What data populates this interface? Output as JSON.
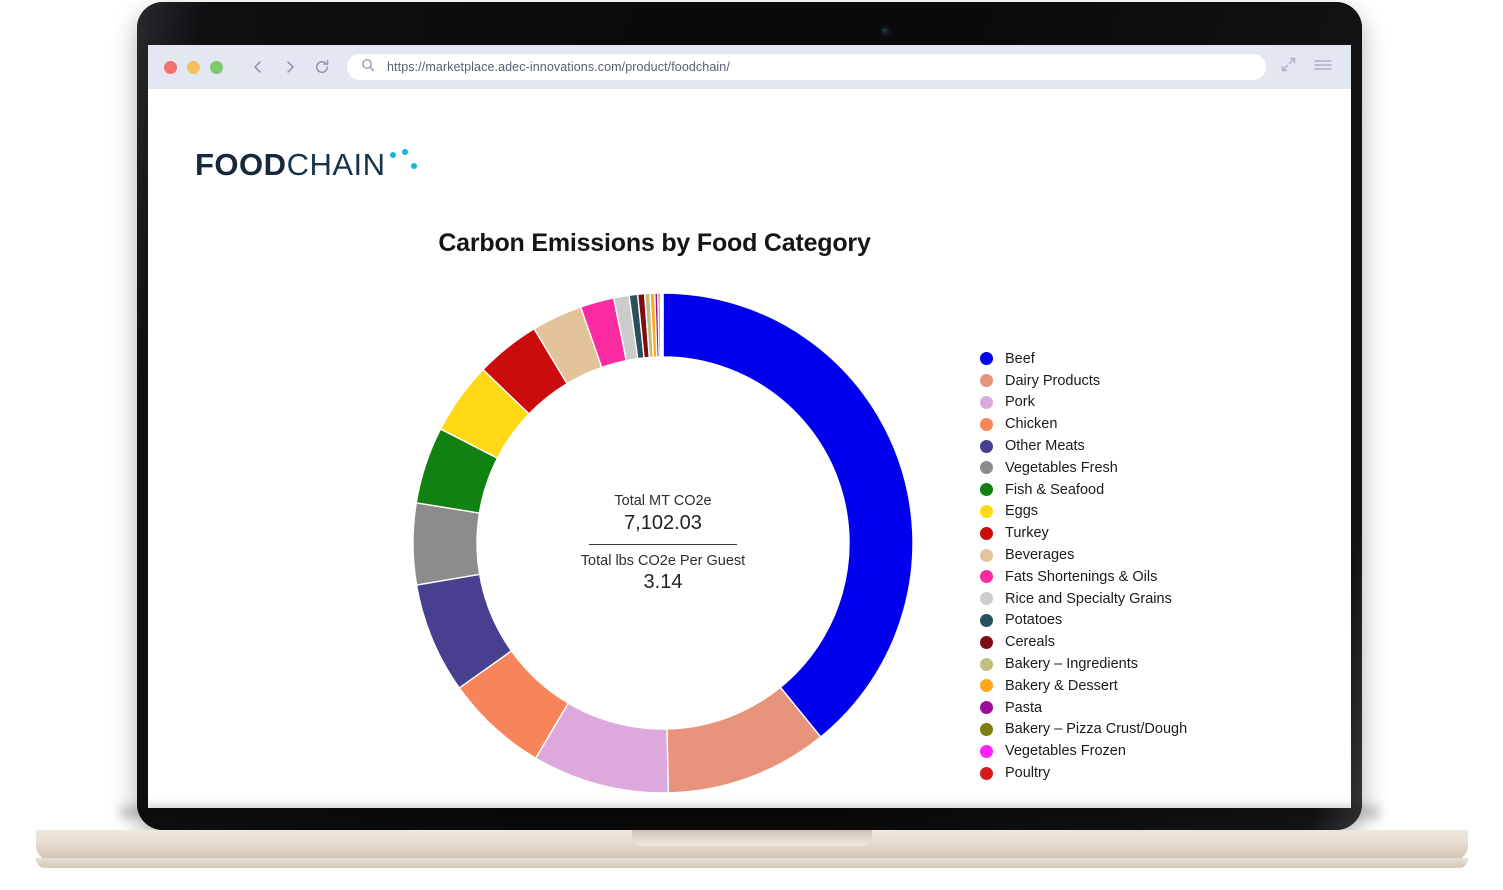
{
  "browser": {
    "url": "https://marketplace.adec-innovations.com/product/foodchain/",
    "traffic_lights": [
      "close",
      "minimize",
      "maximize"
    ],
    "back_icon": "chevron-left-icon",
    "forward_icon": "chevron-right-icon",
    "reload_icon": "reload-icon",
    "search_icon": "search-icon",
    "fullscreen_icon": "expand-arrows-icon",
    "menu_icon": "hamburger-menu-icon"
  },
  "brand": {
    "word_bold": "FOOD",
    "word_light": "CHAIN",
    "dot_color": "#12b6d6",
    "text_color": "#16283a"
  },
  "center": {
    "total_label": "Total MT CO2e",
    "total_value": "7,102.03",
    "per_guest_label": "Total lbs CO2e Per Guest",
    "per_guest_value": "3.14"
  },
  "chart_data": {
    "type": "pie",
    "variant": "donut",
    "title": "Carbon Emissions by Food Category",
    "xlabel": "",
    "ylabel": "",
    "legend_position": "right",
    "grid": false,
    "units": "MT CO2e",
    "total": 7102.03,
    "start_angle_deg": 0,
    "direction": "clockwise",
    "categories": [
      "Beef",
      "Dairy Products",
      "Pork",
      "Chicken",
      "Other Meats",
      "Vegetables Fresh",
      "Fish & Seafood",
      "Eggs",
      "Turkey",
      "Beverages",
      "Fats Shortenings & Oils",
      "Rice and Specialty Grains",
      "Potatoes",
      "Cereals",
      "Bakery – Ingredients",
      "Bakery & Dessert",
      "Pasta",
      "Bakery – Pizza Crust/Dough",
      "Vegetables Frozen",
      "Poultry"
    ],
    "values": [
      39.4,
      10.6,
      8.9,
      6.7,
      7.2,
      5.3,
      5.0,
      4.7,
      4.2,
      3.3,
      2.2,
      1.0,
      0.55,
      0.45,
      0.35,
      0.3,
      0.2,
      0.15,
      0.1,
      0.08
    ],
    "value_unit": "percent",
    "colors": [
      "#0000ee",
      "#e8937b",
      "#dda9dd",
      "#f8855a",
      "#473f8f",
      "#8c8c8c",
      "#118211",
      "#ffd915",
      "#cc0c0c",
      "#e2c39a",
      "#fa2ba0",
      "#cccccc",
      "#2a5159",
      "#7d0d12",
      "#bfc080",
      "#ffa51e",
      "#9c0f9c",
      "#7d7d10",
      "#ff22ff",
      "#d41c1c"
    ]
  }
}
